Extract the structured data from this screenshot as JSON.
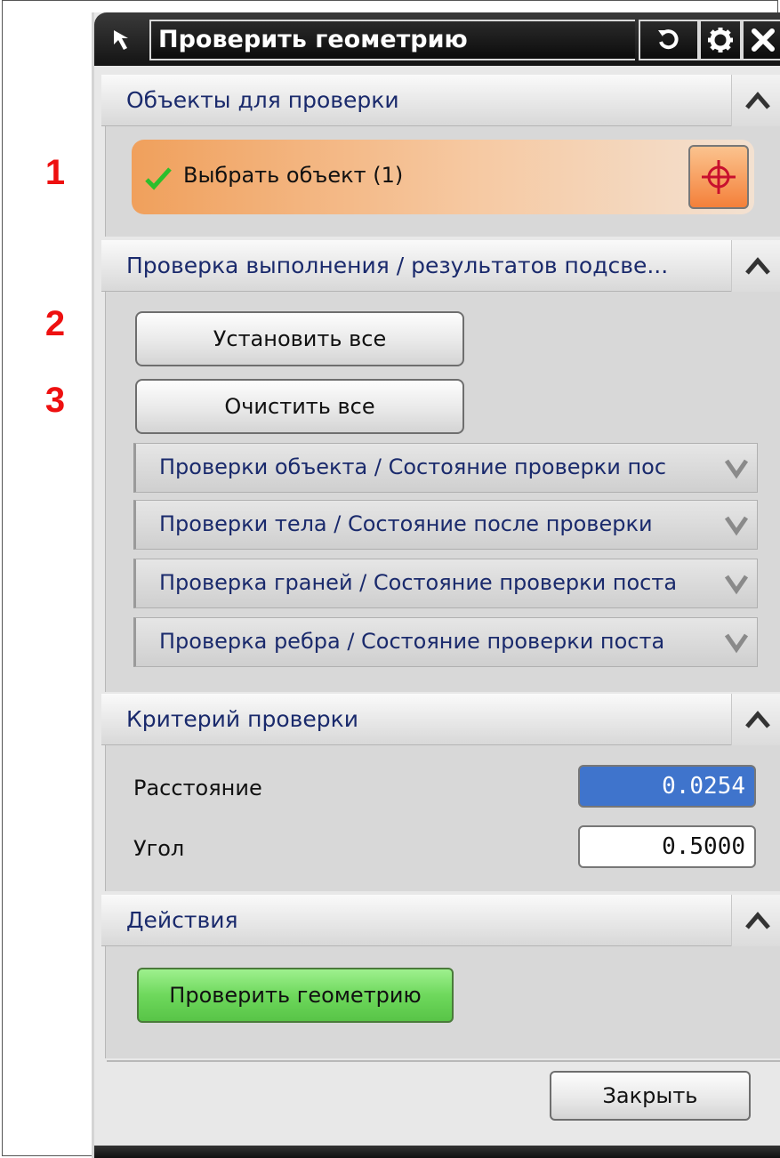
{
  "annotations": [
    "1",
    "2",
    "3"
  ],
  "titlebar": {
    "title": "Проверить геометрию",
    "icons": [
      "select-arrow-icon",
      "reset-icon",
      "gear-icon",
      "close-icon"
    ]
  },
  "sections": {
    "objects": {
      "title": "Объекты для проверки",
      "select_label": "Выбрать объект (1)"
    },
    "checks": {
      "title": "Проверка выполнения / результатов подсве...",
      "set_all": "Установить все",
      "clear_all": "Очистить все",
      "subsections": [
        "Проверки объекта / Состояние проверки пос",
        "Проверки тела / Состояние после проверки",
        "Проверка граней / Состояние проверки поста",
        "Проверка ребра / Состояние проверки поста"
      ]
    },
    "criteria": {
      "title": "Критерий проверки",
      "distance_label": "Расстояние",
      "distance_value": "0.0254",
      "angle_label": "Угол",
      "angle_value": "0.5000"
    },
    "actions": {
      "title": "Действия",
      "check_button": "Проверить геометрию"
    }
  },
  "footer": {
    "close_label": "Закрыть"
  },
  "colors": {
    "accent_orange": "#f4803a",
    "header_text": "#1a2a6c",
    "active_field": "#3f74cc",
    "green_button": "#6ed85c",
    "annotation_red": "#ee1010"
  }
}
